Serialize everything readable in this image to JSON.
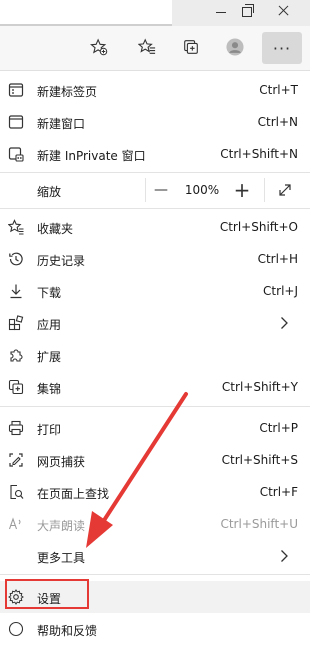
{
  "menu": {
    "new_tab": {
      "label": "新建标签页",
      "shortcut": "Ctrl+T"
    },
    "new_window": {
      "label": "新建窗口",
      "shortcut": "Ctrl+N"
    },
    "new_inprivate": {
      "label": "新建 InPrivate 窗口",
      "shortcut": "Ctrl+Shift+N"
    },
    "zoom": {
      "label": "缩放",
      "minus": "—",
      "value": "100%",
      "plus": "+"
    },
    "favorites": {
      "label": "收藏夹",
      "shortcut": "Ctrl+Shift+O"
    },
    "history": {
      "label": "历史记录",
      "shortcut": "Ctrl+H"
    },
    "downloads": {
      "label": "下载",
      "shortcut": "Ctrl+J"
    },
    "apps": {
      "label": "应用"
    },
    "extensions": {
      "label": "扩展"
    },
    "collections": {
      "label": "集锦",
      "shortcut": "Ctrl+Shift+Y"
    },
    "print": {
      "label": "打印",
      "shortcut": "Ctrl+P"
    },
    "web_capture": {
      "label": "网页捕获",
      "shortcut": "Ctrl+Shift+S"
    },
    "find": {
      "label": "在页面上查找",
      "shortcut": "Ctrl+F"
    },
    "read_aloud": {
      "label": "大声朗读",
      "shortcut": "Ctrl+Shift+U"
    },
    "more_tools": {
      "label": "更多工具"
    },
    "settings": {
      "label": "设置"
    },
    "help": {
      "label": "帮助和反馈"
    }
  },
  "toolbar": {
    "more_label": "···"
  },
  "colors": {
    "highlight": "#e53935",
    "arrow": "#e53935"
  }
}
